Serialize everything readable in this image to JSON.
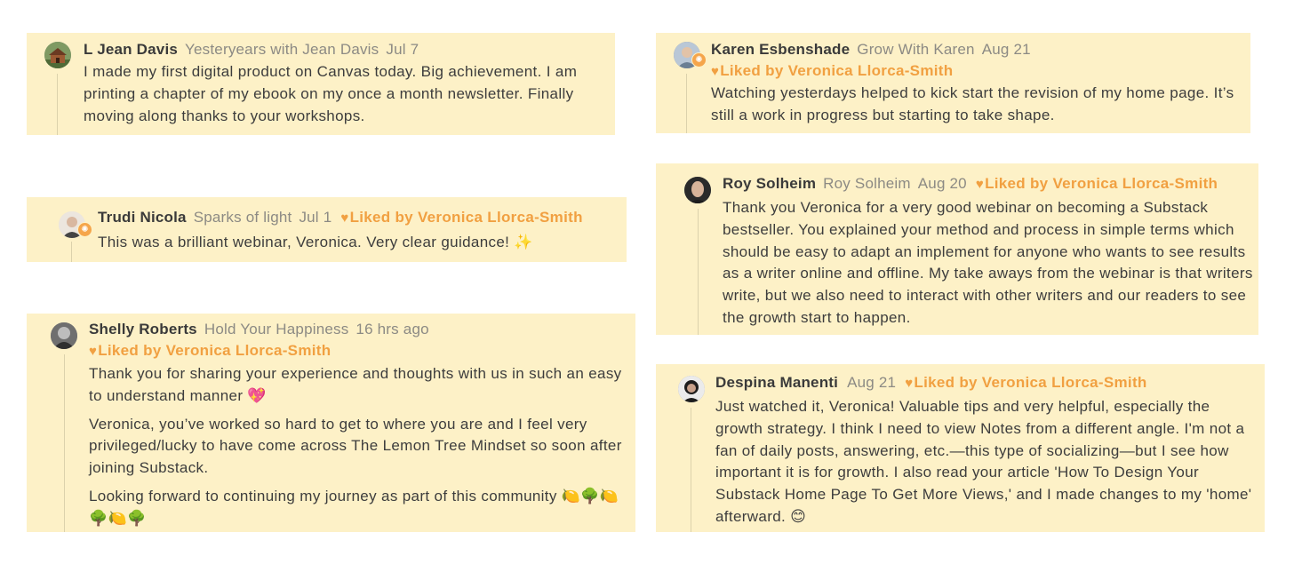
{
  "notes": [
    {
      "id": "jean",
      "author": "L Jean Davis",
      "publication": "Yesteryears with Jean Davis",
      "date": "Jul 7",
      "liked_by": "",
      "avatar": "house-avatar",
      "paragraphs": [
        "I made my first digital product on Canvas today. Big achievement. I am printing a chapter of my ebook on my once a month newsletter. Finally moving along thanks to your workshops."
      ]
    },
    {
      "id": "trudi",
      "author": "Trudi Nicola",
      "publication": "Sparks of light",
      "date": "Jul 1",
      "liked_by": "Liked by Veronica Llorca-Smith",
      "avatar": "person-avatar",
      "paragraphs": [
        "This was a brilliant webinar, Veronica. Very clear guidance! ✨"
      ]
    },
    {
      "id": "shelly",
      "author": "Shelly Roberts",
      "publication": "Hold Your Happiness",
      "date": "16 hrs ago",
      "liked_by": "Liked by Veronica Llorca-Smith",
      "avatar": "person-avatar",
      "paragraphs": [
        "Thank you for sharing your experience and thoughts with us in such an easy to understand manner 💖",
        "Veronica, you’ve worked so hard to get to where you are and I feel very privileged/lucky to have come across The Lemon Tree Mindset so soon after joining Substack.",
        "Looking forward to continuing my journey as part of this community 🍋🌳🍋🌳🍋🌳"
      ]
    },
    {
      "id": "karen",
      "author": "Karen Esbenshade",
      "publication": "Grow With Karen",
      "date": "Aug 21",
      "liked_by": "Liked by Veronica Llorca-Smith",
      "avatar": "person-avatar",
      "paragraphs": [
        "Watching yesterdays helped to kick start the revision of my home page. It’s still a work in progress but starting to take shape."
      ]
    },
    {
      "id": "roy",
      "author": "Roy Solheim",
      "publication": "Roy Solheim",
      "date": "Aug 20",
      "liked_by": "Liked by Veronica Llorca-Smith",
      "avatar": "person-avatar",
      "paragraphs": [
        "Thank you Veronica for a very good webinar on becoming a Substack bestseller. You explained your method and process in simple terms which should be easy to adapt an implement for anyone who wants to see results as a writer online and offline. My take aways from the webinar is that writers write, but we also need to interact with other writers and our readers to see the growth start to happen."
      ]
    },
    {
      "id": "despina",
      "author": "Despina Manenti",
      "publication": "",
      "date": "Aug 21",
      "liked_by": "Liked by Veronica Llorca-Smith",
      "avatar": "person-avatar",
      "paragraphs": [
        "Just watched it, Veronica! Valuable tips and very helpful, especially the growth strategy. I think I need to view Notes from a different angle. I'm not a fan of daily posts, answering, etc.—this type of socializing—but I see how important it is for growth. I also read your article 'How To Design Your Substack Home Page To Get More Views,' and I made changes to my 'home' afterward. 😊"
      ]
    }
  ],
  "icons": {
    "heart": "heart-icon",
    "bestseller_badge": "bestseller-badge-icon"
  },
  "colors": {
    "card_background": "#fdf1c7",
    "liked_accent": "#f1a041",
    "meta_grey": "#8c8a84",
    "text": "#3d3d3d"
  }
}
